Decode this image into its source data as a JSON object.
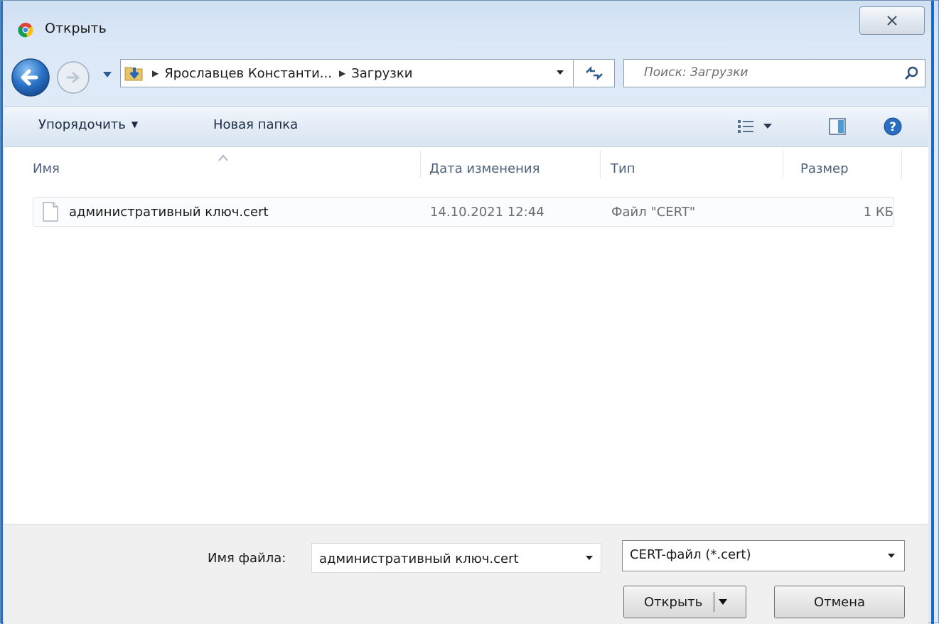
{
  "window": {
    "title": "Открыть",
    "icons": {
      "app": "chrome-icon",
      "close": "close-icon"
    }
  },
  "nav": {
    "breadcrumb": [
      "Ярославцев Константи...",
      "Загрузки"
    ],
    "search_placeholder": "Поиск: Загрузки",
    "icons": [
      "back-arrow-icon",
      "forward-arrow-icon",
      "history-dropdown-icon",
      "downloads-folder-icon",
      "refresh-icon",
      "search-icon"
    ]
  },
  "toolbar": {
    "organize_label": "Упорядочить",
    "new_folder_label": "Новая папка",
    "icons": [
      "views-icon",
      "preview-pane-icon",
      "help-icon"
    ]
  },
  "filelist": {
    "columns": [
      "Имя",
      "Дата изменения",
      "Тип",
      "Размер"
    ],
    "rows": [
      {
        "name": "административный ключ.cert",
        "date": "14.10.2021 12:44",
        "type": "Файл \"CERT\"",
        "size": "1 КБ"
      }
    ]
  },
  "bottom": {
    "filename_label": "Имя файла:",
    "filename_value": "административный ключ.cert",
    "filetype_value": "CERT-файл (*.cert)",
    "open_label": "Открыть",
    "cancel_label": "Отмена"
  },
  "colors": {
    "accent_border": "#1a6bc9",
    "chrome_bg": "#dfeaf7",
    "list_bg": "#ffffff"
  }
}
